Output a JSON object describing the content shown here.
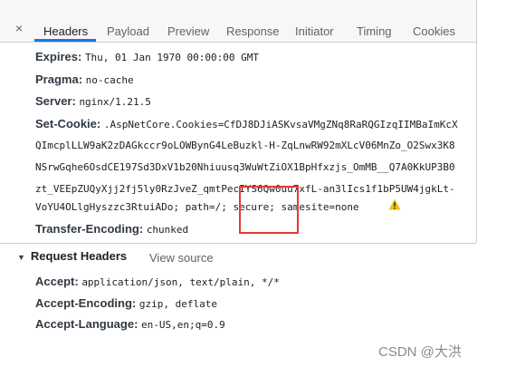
{
  "tabs": [
    {
      "label": "Headers"
    },
    {
      "label": "Payload"
    },
    {
      "label": "Preview"
    },
    {
      "label": "Response"
    },
    {
      "label": "Initiator"
    },
    {
      "label": "Timing"
    },
    {
      "label": "Cookies"
    }
  ],
  "close_glyph": "×",
  "response_headers": {
    "expires": {
      "name": "Expires:",
      "value": "Thu, 01 Jan 1970 00:00:00 GMT"
    },
    "pragma": {
      "name": "Pragma:",
      "value": "no-cache"
    },
    "server": {
      "name": "Server:",
      "value": "nginx/1.21.5"
    },
    "set_cookie": {
      "name": "Set-Cookie:",
      "lines": [
        ".AspNetCore.Cookies=CfDJ8DJiASKvsaVMgZNq8RaRQGIzqIIMBaImKcX",
        "QImcplLLW9aK2zDAGkccr9oLOWBynG4LeBuzkl-H-ZqLnwRW92mXLcV06MnZo_O2Swx3K8",
        "NSrwGqhe6OsdCE197Sd3DxV1b20Nhiuusq3WuWtZiOX1BpHfxzjs_OmMB__Q7A0KkUP3B0",
        "zt_VEEpZUQyXjj2fj5ly0RzJveZ_qmtPecIYS6Qw0uu7xfL-an3lIcs1f1bP5UW4jgkLt-",
        "VoYU4OLlgHyszzc3RtuiADo; path=/; secure; samesite=none"
      ]
    },
    "transfer_encoding": {
      "name": "Transfer-Encoding:",
      "value": "chunked"
    }
  },
  "request_headers": {
    "title": "Request Headers",
    "view_source": "View source",
    "accept": {
      "name": "Accept:",
      "value": "application/json, text/plain, */*"
    },
    "accept_encoding": {
      "name": "Accept-Encoding:",
      "value": "gzip, deflate"
    },
    "accept_language": {
      "name": "Accept-Language:",
      "value": "en-US,en;q=0.9"
    }
  },
  "watermark": "CSDN @大洪",
  "colors": {
    "accent": "#1a73e8",
    "highlight_box": "#e53935",
    "warning": "#f2c200"
  }
}
